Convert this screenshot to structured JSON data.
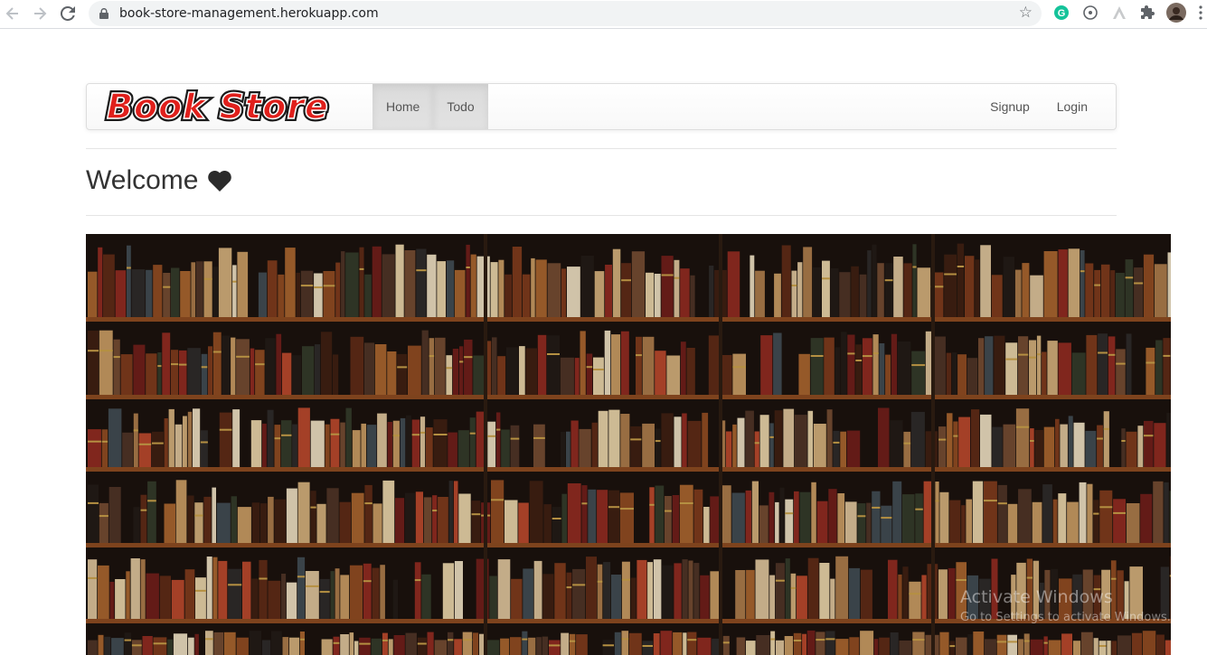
{
  "browser": {
    "url": "book-store-management.herokuapp.com"
  },
  "navbar": {
    "brand_text": "Book Store",
    "links": [
      {
        "label": "Home"
      },
      {
        "label": "Todo"
      }
    ],
    "right_links": [
      {
        "label": "Signup"
      },
      {
        "label": "Login"
      }
    ]
  },
  "main": {
    "heading": "Welcome"
  },
  "watermark": {
    "line1": "Activate Windows",
    "line2": "Go to Settings to activate Windows."
  },
  "colors": {
    "brand_red": "#e0201c",
    "shelf_wood": "#8a4b20"
  },
  "icons": [
    "back-arrow-icon",
    "forward-arrow-icon",
    "reload-icon",
    "lock-icon",
    "star-icon",
    "grammarly-icon",
    "extension-icon",
    "puzzle-icon",
    "profile-avatar",
    "menu-icon",
    "heart-icon"
  ]
}
